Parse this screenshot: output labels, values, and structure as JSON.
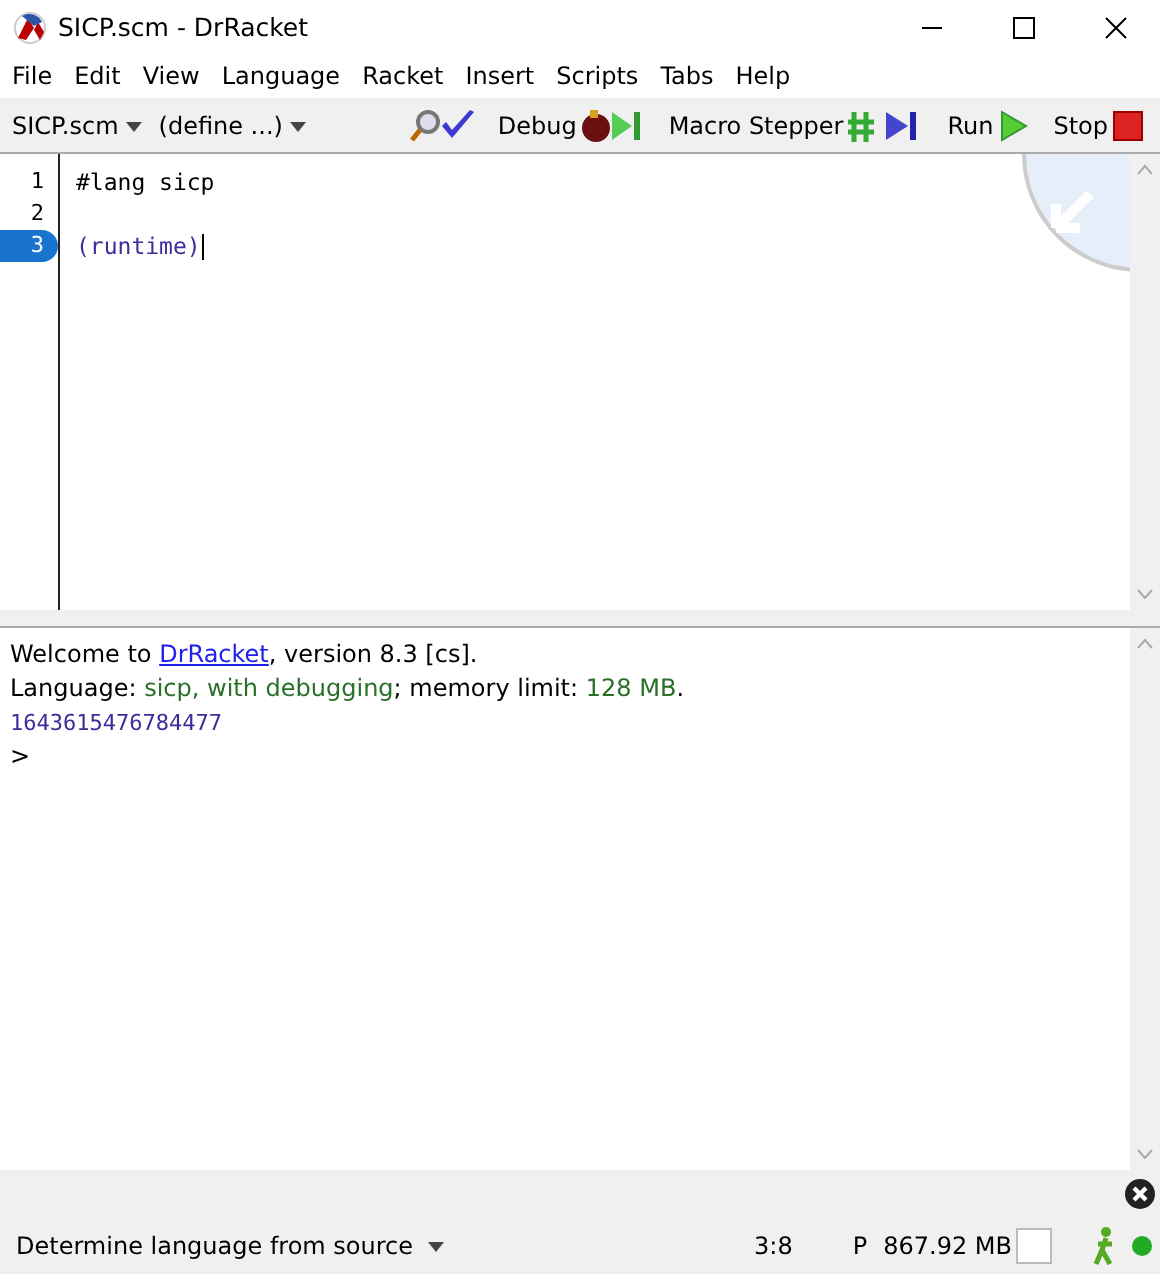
{
  "window": {
    "title": "SICP.scm - DrRacket"
  },
  "menu": [
    "File",
    "Edit",
    "View",
    "Language",
    "Racket",
    "Insert",
    "Scripts",
    "Tabs",
    "Help"
  ],
  "toolbar": {
    "file_menu": "SICP.scm",
    "define_menu": "(define ...)",
    "buttons": [
      {
        "label": "Debug",
        "kind": "debug"
      },
      {
        "label": "Macro Stepper",
        "kind": "macro"
      },
      {
        "label": "Run",
        "kind": "run"
      },
      {
        "label": "Stop",
        "kind": "stop"
      }
    ]
  },
  "editor": {
    "lines": [
      {
        "number": "1",
        "text": "#lang sicp",
        "kind": "plain",
        "selected": false
      },
      {
        "number": "2",
        "kind": "plain",
        "selected": false
      },
      {
        "number": "3",
        "text": "(runtime)",
        "kind": "expr",
        "selected": true
      }
    ]
  },
  "repl": {
    "lines": [
      {
        "kind": "text",
        "segments": [
          {
            "kind": "plain",
            "text": "Welcome to "
          },
          {
            "kind": "link",
            "text": "DrRacket"
          },
          {
            "kind": "plain",
            "text": ", version 8.3 [cs]."
          }
        ]
      },
      {
        "kind": "text",
        "segments": [
          {
            "kind": "plain",
            "text": "Language: "
          },
          {
            "kind": "green",
            "text": "sicp, with debugging"
          },
          {
            "kind": "plain",
            "text": "; memory limit: "
          },
          {
            "kind": "green",
            "text": "128 MB"
          },
          {
            "kind": "plain",
            "text": "."
          }
        ]
      },
      {
        "kind": "result",
        "segments": [
          {
            "kind": "plain",
            "text": "1643615476784477"
          }
        ]
      },
      {
        "kind": "prompt",
        "segments": [
          {
            "kind": "plain",
            "text": ">"
          }
        ]
      }
    ]
  },
  "status_bar": {
    "language": "Determine language from source",
    "position": "3:8",
    "mode": "P",
    "memory": "867.92 MB"
  }
}
